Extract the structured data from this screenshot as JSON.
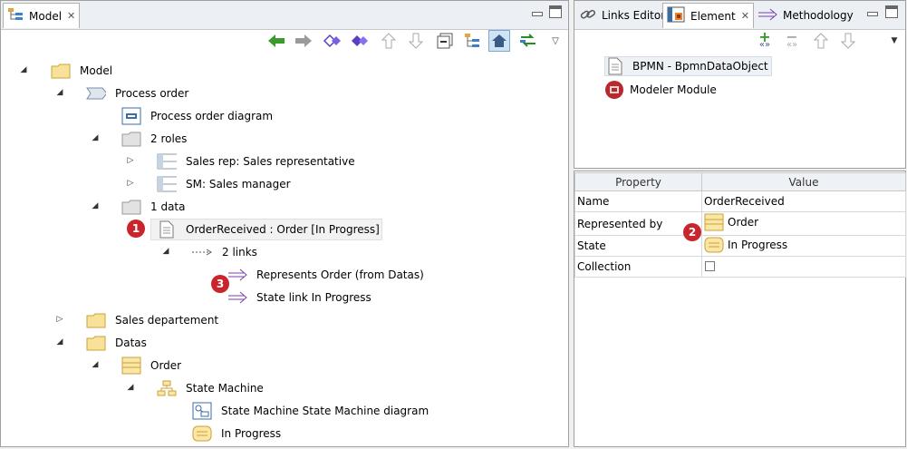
{
  "left_panel": {
    "tab_title": "Model",
    "tree": {
      "model": "Model",
      "process_order": "Process order",
      "process_order_diagram": "Process order diagram",
      "roles": "2 roles",
      "sales_rep": "Sales rep: Sales representative",
      "sm": "SM: Sales manager",
      "data": "1 data",
      "order_received": "OrderReceived : Order [In Progress]",
      "links": "2 links",
      "represents": "Represents Order (from Datas)",
      "state_link": "State link In Progress",
      "sales_dept": "Sales departement",
      "datas": "Datas",
      "order": "Order",
      "state_machine": "State Machine",
      "sm_diagram": "State Machine State Machine diagram",
      "in_progress": "In Progress"
    }
  },
  "right_panel": {
    "tabs": {
      "links_editor": "Links Editor",
      "element": "Element",
      "methodology": "Methodology"
    },
    "elements": {
      "bpmn": "BPMN - BpmnDataObject",
      "modeler": "Modeler Module"
    },
    "properties": {
      "header_property": "Property",
      "header_value": "Value",
      "rows": [
        {
          "name": "Name",
          "value": "OrderReceived"
        },
        {
          "name": "Represented by",
          "value": "Order"
        },
        {
          "name": "State",
          "value": "In Progress"
        },
        {
          "name": "Collection",
          "value": ""
        }
      ]
    }
  },
  "badges": [
    "1",
    "2",
    "3"
  ],
  "colors": {
    "badge": "#c8262c",
    "link_arrow": "#7a3fb0",
    "nav_green": "#3a9a2c",
    "folder": "#f5d77a"
  }
}
